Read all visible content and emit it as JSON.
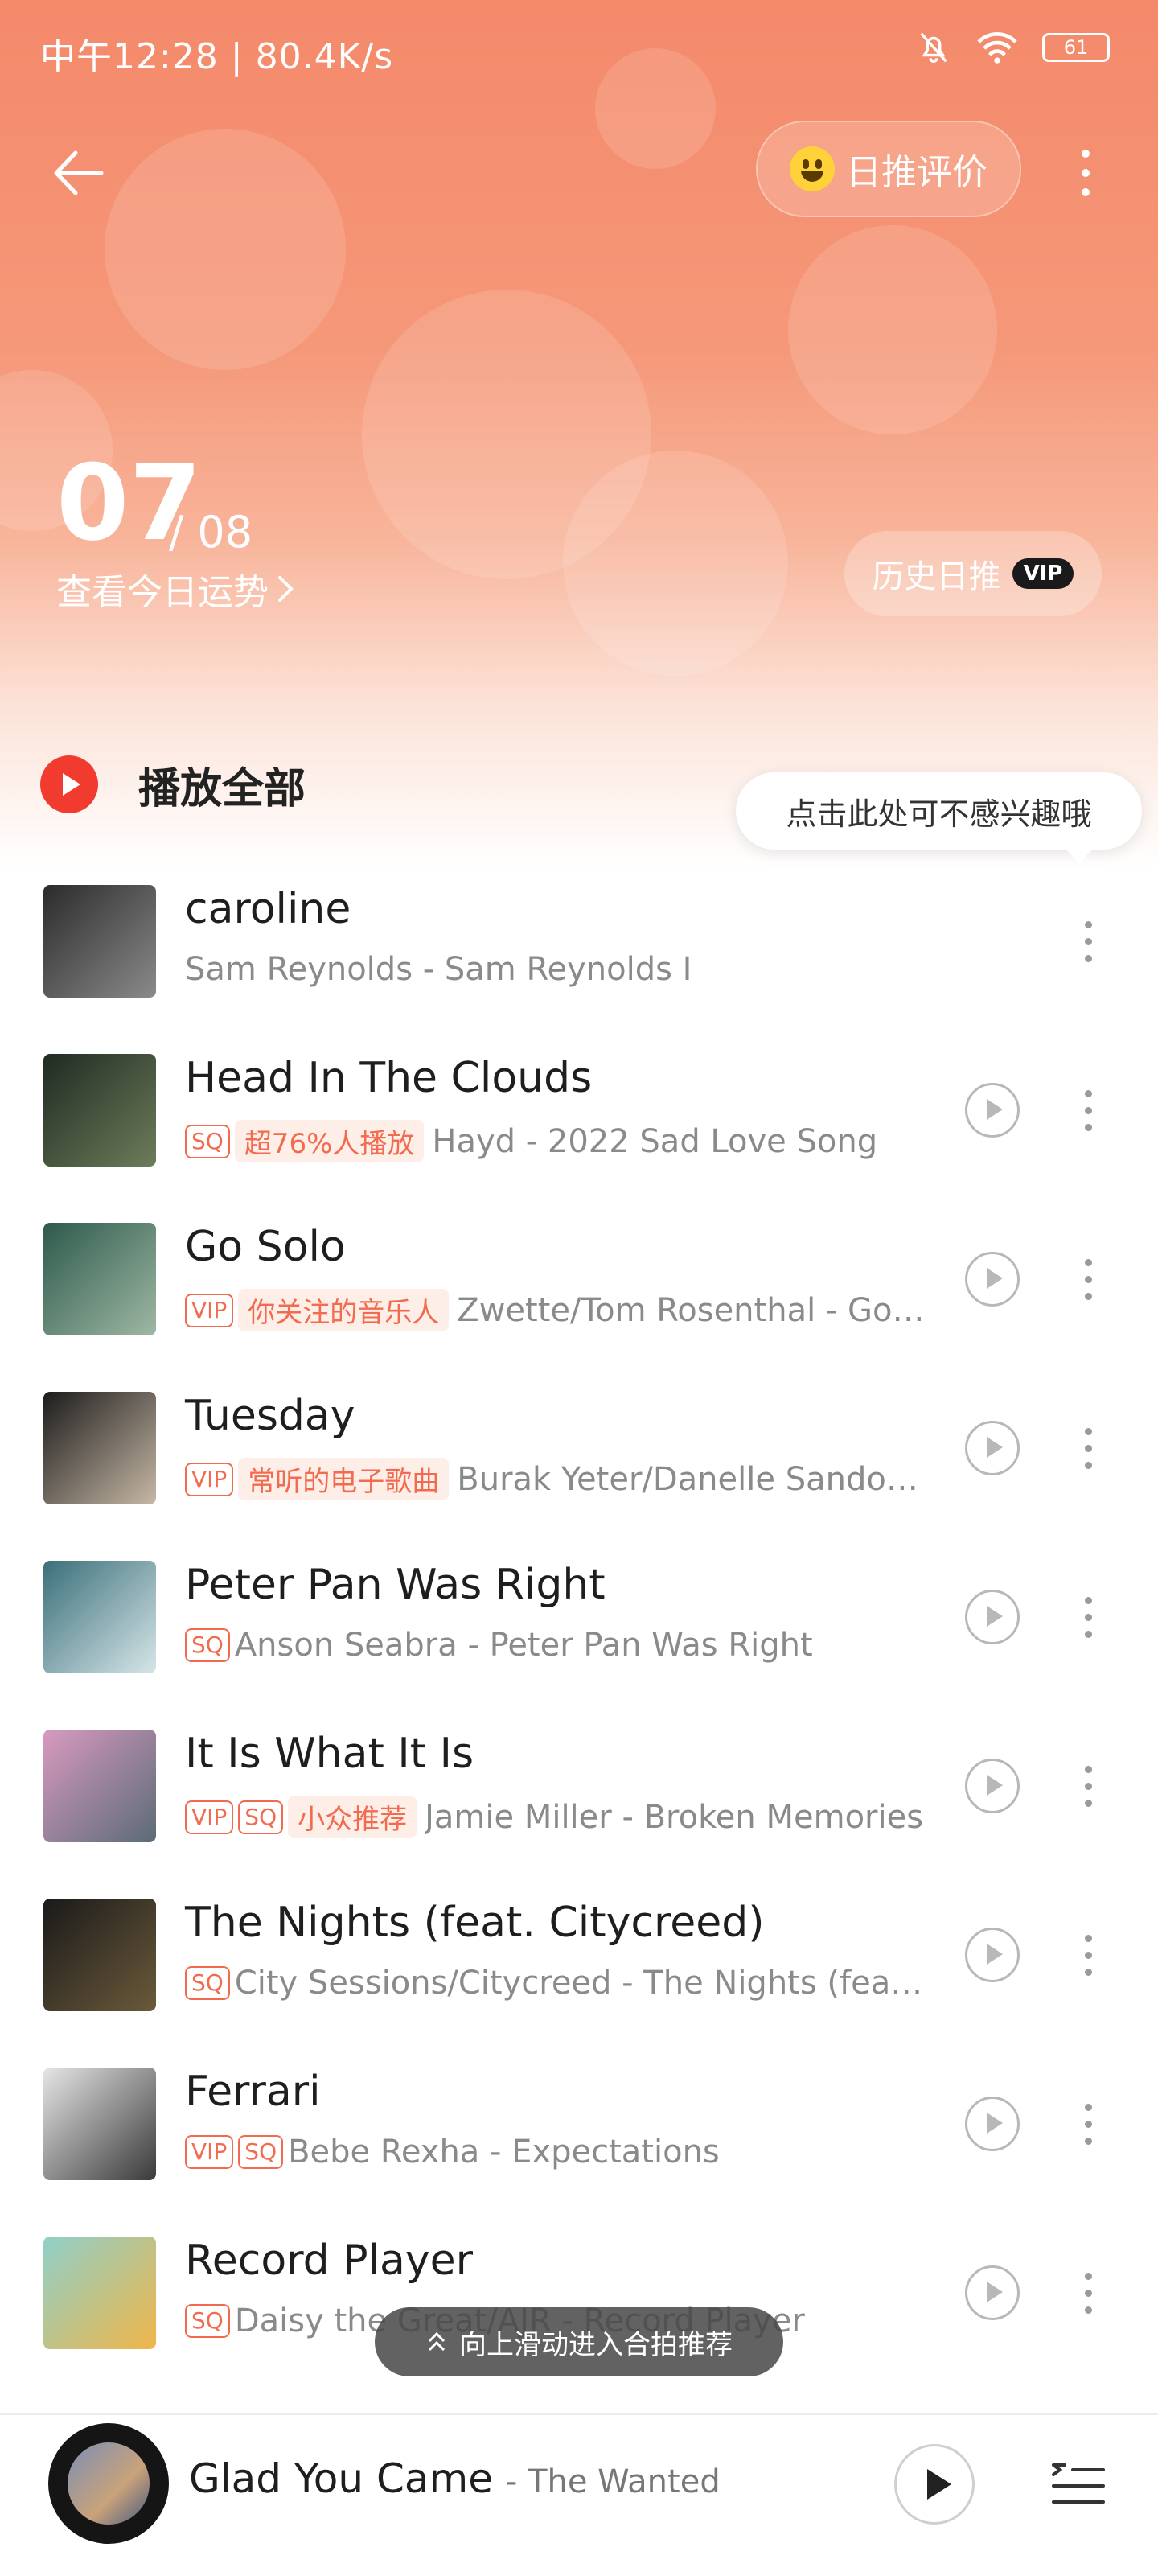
{
  "status": {
    "time": "中午12:28 | 80.4K/s",
    "battery": "61"
  },
  "header": {
    "rate_label": "日推评价",
    "date_day": "07",
    "date_month": "/ 08",
    "fortune_label": "查看今日运势",
    "history_label": "历史日推",
    "history_badge": "VIP"
  },
  "play_all_label": "播放全部",
  "tooltip": "点击此处可不感兴趣哦",
  "songs": [
    {
      "title": "caroline",
      "tags": [],
      "rec": "",
      "meta": "Sam Reynolds - Sam Reynolds I",
      "cover": [
        "#2b2b2b",
        "#8a8a8a"
      ]
    },
    {
      "title": "Head In The Clouds",
      "tags": [
        "SQ"
      ],
      "rec": "超76%人播放",
      "meta": "Hayd - 2022 Sad Love Song",
      "cover": [
        "#1f2a22",
        "#6d7d5a"
      ]
    },
    {
      "title": "Go Solo",
      "tags": [
        "VIP"
      ],
      "rec": "你关注的音乐人",
      "meta": "Zwette/Tom Rosenthal - Go Solo",
      "cover": [
        "#2d5a4c",
        "#9fb8a4"
      ]
    },
    {
      "title": "Tuesday",
      "tags": [
        "VIP"
      ],
      "rec": "常听的电子歌曲",
      "meta": "Burak Yeter/Danelle Sandoval - Tuesday",
      "cover": [
        "#1c1c1c",
        "#c7b8a6"
      ]
    },
    {
      "title": "Peter Pan Was Right",
      "tags": [
        "SQ"
      ],
      "rec": "",
      "meta": "Anson Seabra - Peter Pan Was Right",
      "cover": [
        "#3b6f7a",
        "#d6e6e8"
      ]
    },
    {
      "title": "It Is What It Is",
      "tags": [
        "VIP",
        "SQ"
      ],
      "rec": "小众推荐",
      "meta": "Jamie Miller - Broken Memories",
      "cover": [
        "#d89abf",
        "#5b6b78"
      ]
    },
    {
      "title": "The Nights (feat. Citycreed)",
      "tags": [
        "SQ"
      ],
      "rec": "",
      "meta": "City Sessions/Citycreed - The Nights (feat. Citycreed)",
      "cover": [
        "#1a1a1a",
        "#6b5a3a"
      ]
    },
    {
      "title": "Ferrari",
      "tags": [
        "VIP",
        "SQ"
      ],
      "rec": "",
      "meta": "Bebe Rexha - Expectations",
      "cover": [
        "#e6e6e6",
        "#3a3a3a"
      ]
    },
    {
      "title": "Record Player",
      "tags": [
        "SQ"
      ],
      "rec": "",
      "meta": "Daisy the Great/AJR - Record Player",
      "cover": [
        "#8fd0c8",
        "#f0b54a"
      ]
    }
  ],
  "swipe_hint": "向上滑动进入合拍推荐",
  "player": {
    "title": "Glad You Came",
    "artist": "- The Wanted"
  },
  "colors": {
    "accent": "#f23b2f",
    "tag": "#f26b4f",
    "hero_top": "#f4896a"
  }
}
